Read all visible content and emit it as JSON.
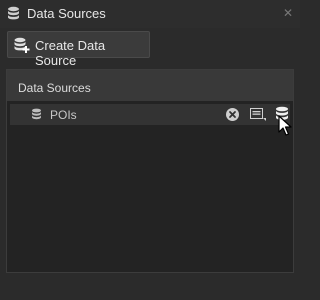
{
  "window": {
    "title": "Data Sources",
    "icon": "database-icon",
    "close_icon": "close-icon"
  },
  "toolbar": {
    "create_label": "Create Data Source",
    "create_icon": "database-add-icon"
  },
  "panel": {
    "title": "Data Sources",
    "items": [
      {
        "label": "POIs",
        "icon": "database-icon",
        "actions": [
          "clear-icon",
          "properties-icon",
          "database-actions-icon"
        ]
      }
    ]
  },
  "colors": {
    "background": "#2b2b2b",
    "panel": "#232323",
    "panel_header": "#393939",
    "row": "#333333",
    "text": "#d8d8d8"
  }
}
